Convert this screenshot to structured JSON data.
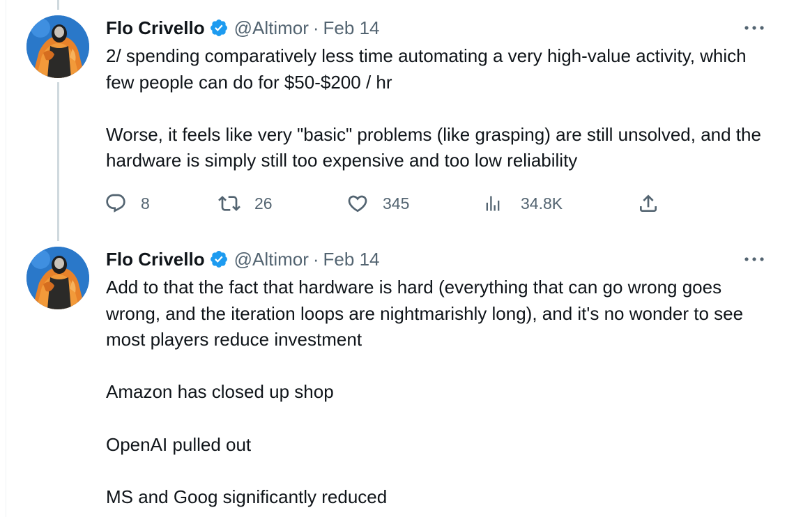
{
  "tweets": [
    {
      "author": {
        "name": "Flo Crivello",
        "handle": "@Altimor",
        "separator": "·",
        "date": "Feb 14",
        "verified": true
      },
      "paragraphs": [
        "2/ spending comparatively less time automating a very high-value activity, which few people can do for $50-$200 / hr",
        "Worse, it feels like very \"basic\" problems (like grasping) are still unsolved, and the hardware is simply still too expensive and too low reliability"
      ],
      "stats": {
        "replies": "8",
        "retweets": "26",
        "likes": "345",
        "views": "34.8K"
      }
    },
    {
      "author": {
        "name": "Flo Crivello",
        "handle": "@Altimor",
        "separator": "·",
        "date": "Feb 14",
        "verified": true
      },
      "paragraphs": [
        "Add to that the fact that hardware is hard (everything that can go wrong goes wrong, and the iteration loops are nightmarishly long), and it's no wonder to see most players reduce investment",
        "Amazon has closed up shop",
        "OpenAI pulled out",
        "MS and Goog significantly reduced"
      ]
    }
  ],
  "icons": {
    "more": "more-horizontal-icon",
    "verified": "verified-badge-icon",
    "reply": "reply-icon",
    "retweet": "retweet-icon",
    "like": "heart-icon",
    "views": "views-icon",
    "share": "share-icon"
  },
  "colors": {
    "text_primary": "#0f1419",
    "text_secondary": "#536471",
    "verified_blue": "#1d9bf0",
    "thread_line": "#cfd9de"
  }
}
